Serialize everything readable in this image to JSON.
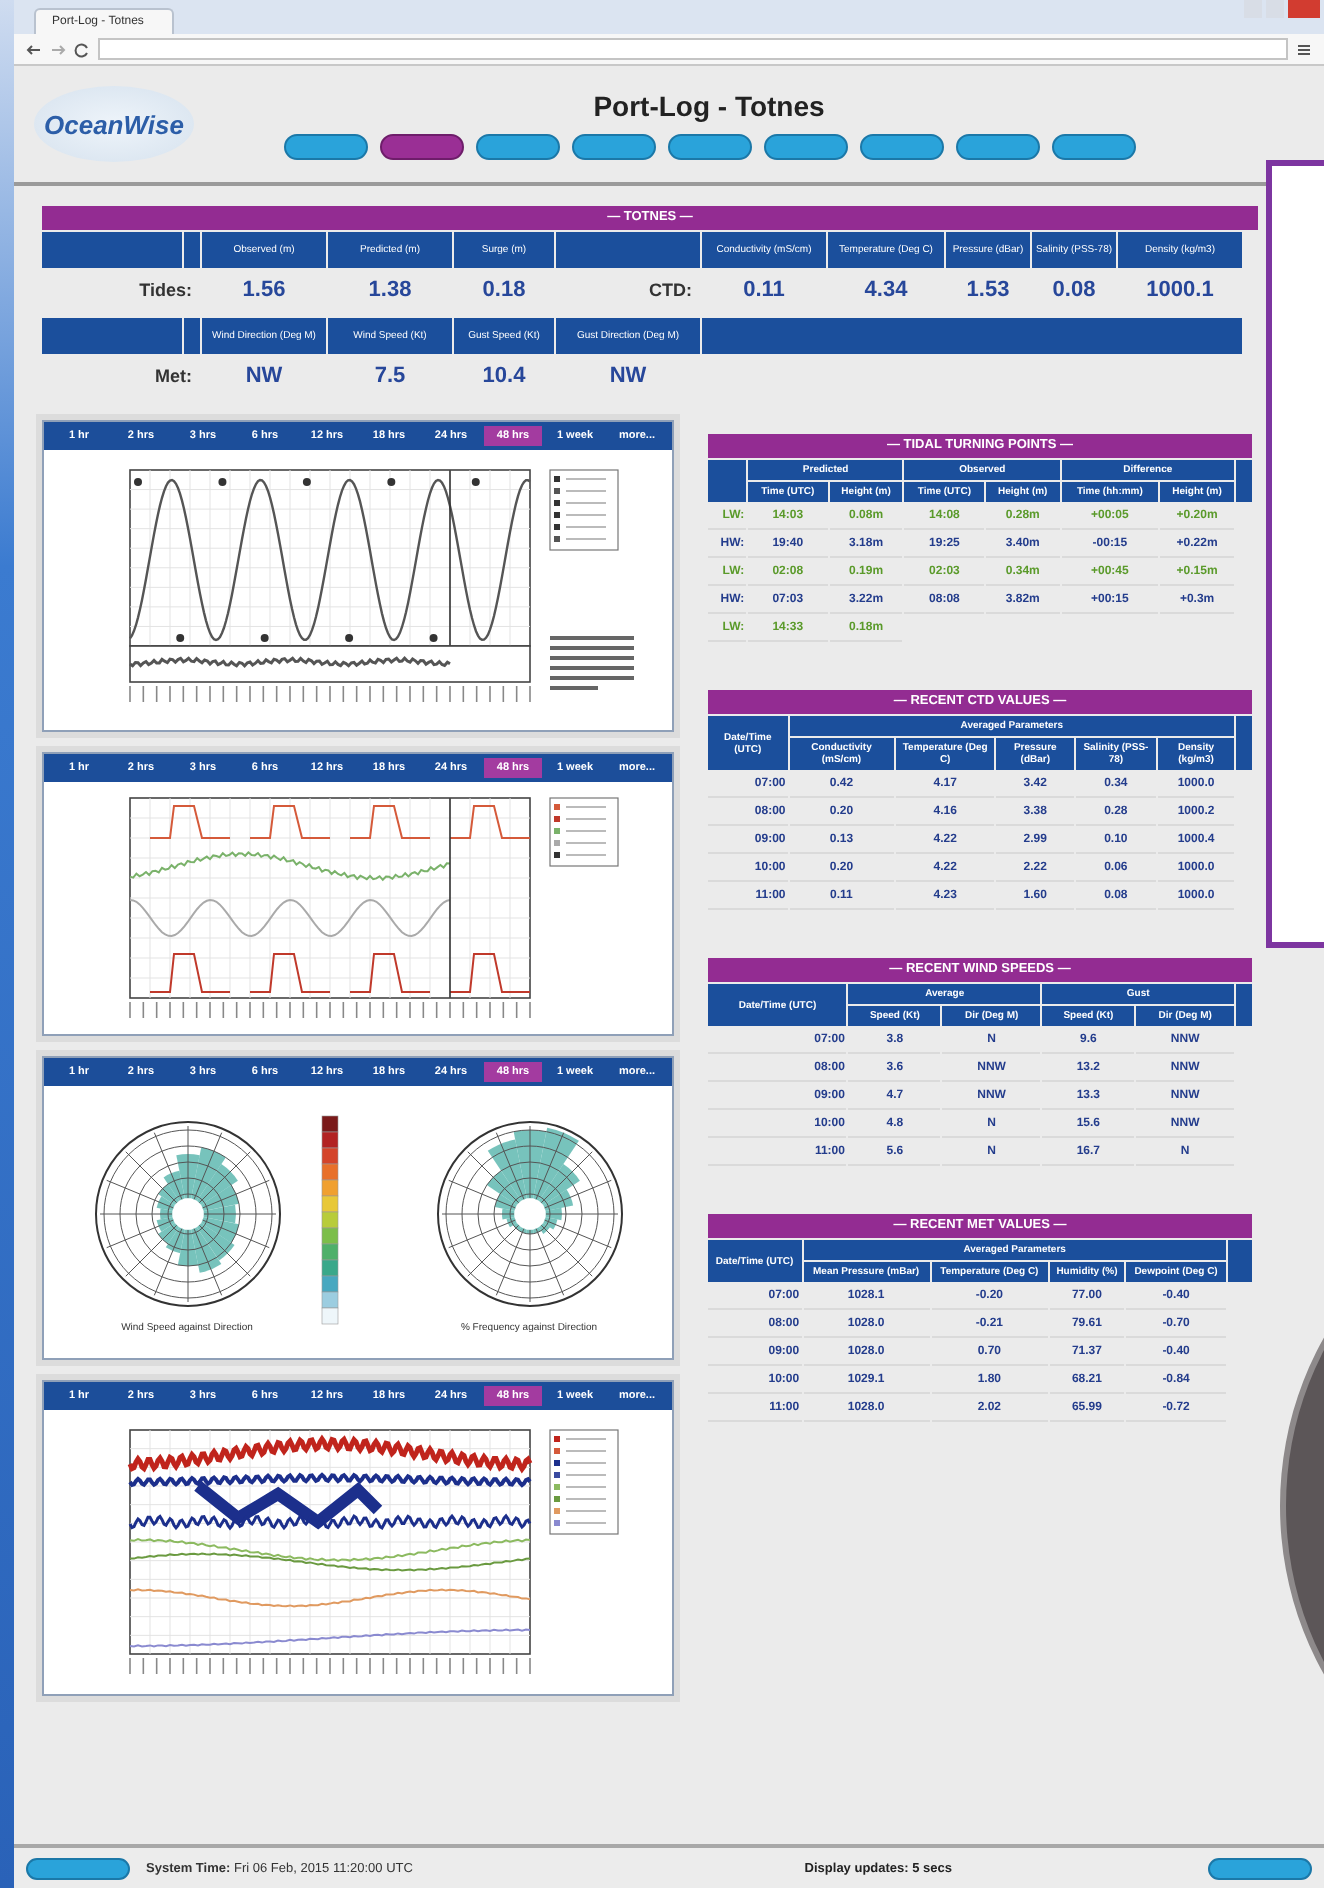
{
  "browser": {
    "tab_title": "Port-Log - Totnes"
  },
  "header": {
    "logo": "OceanWise",
    "title": "Port-Log - Totnes",
    "nav": [
      {
        "selected": false
      },
      {
        "selected": true
      },
      {
        "selected": false
      },
      {
        "selected": false
      },
      {
        "selected": false
      },
      {
        "selected": false
      },
      {
        "selected": false
      },
      {
        "selected": false
      },
      {
        "selected": false
      }
    ]
  },
  "summary": {
    "title": "— TOTNES —",
    "tides": {
      "label": "Tides:",
      "columns": [
        "Observed (m)",
        "Predicted (m)",
        "Surge (m)"
      ],
      "values": [
        "1.56",
        "1.38",
        "0.18"
      ]
    },
    "ctd": {
      "label": "CTD:",
      "columns": [
        "Conductivity (mS/cm)",
        "Temperature (Deg C)",
        "Pressure (dBar)",
        "Salinity (PSS-78)",
        "Density (kg/m3)"
      ],
      "values": [
        "0.11",
        "4.34",
        "1.53",
        "0.08",
        "1000.1"
      ]
    },
    "met": {
      "label": "Met:",
      "columns": [
        "Wind Direction (Deg M)",
        "Wind Speed (Kt)",
        "Gust Speed (Kt)",
        "Gust Direction (Deg M)"
      ],
      "values": [
        "NW",
        "7.5",
        "10.4",
        "NW"
      ]
    }
  },
  "charts": [
    {
      "kind": "tide",
      "tabs": [
        {
          "label": "1 hr",
          "selected": false
        },
        {
          "label": "2 hrs",
          "selected": false
        },
        {
          "label": "3 hrs",
          "selected": false
        },
        {
          "label": "6 hrs",
          "selected": false
        },
        {
          "label": "12 hrs",
          "selected": false
        },
        {
          "label": "18 hrs",
          "selected": false
        },
        {
          "label": "24 hrs",
          "selected": false
        },
        {
          "label": "48 hrs",
          "selected": true
        },
        {
          "label": "1 week",
          "selected": false
        },
        {
          "label": "more...",
          "selected": false
        }
      ]
    },
    {
      "kind": "ctd",
      "tabs": [
        {
          "label": "1 hr",
          "selected": false
        },
        {
          "label": "2 hrs",
          "selected": false
        },
        {
          "label": "3 hrs",
          "selected": false
        },
        {
          "label": "6 hrs",
          "selected": false
        },
        {
          "label": "12 hrs",
          "selected": false
        },
        {
          "label": "18 hrs",
          "selected": false
        },
        {
          "label": "24 hrs",
          "selected": false
        },
        {
          "label": "48 hrs",
          "selected": true
        },
        {
          "label": "1 week",
          "selected": false
        },
        {
          "label": "more...",
          "selected": false
        }
      ]
    },
    {
      "kind": "wind",
      "captions": [
        "Wind Speed against Direction",
        "% Frequency against Direction"
      ],
      "tabs": [
        {
          "label": "1 hr",
          "selected": false
        },
        {
          "label": "2 hrs",
          "selected": false
        },
        {
          "label": "3 hrs",
          "selected": false
        },
        {
          "label": "6 hrs",
          "selected": false
        },
        {
          "label": "12 hrs",
          "selected": false
        },
        {
          "label": "18 hrs",
          "selected": false
        },
        {
          "label": "24 hrs",
          "selected": false
        },
        {
          "label": "48 hrs",
          "selected": true
        },
        {
          "label": "1 week",
          "selected": false
        },
        {
          "label": "more...",
          "selected": false
        }
      ]
    },
    {
      "kind": "met",
      "tabs": [
        {
          "label": "1 hr",
          "selected": false
        },
        {
          "label": "2 hrs",
          "selected": false
        },
        {
          "label": "3 hrs",
          "selected": false
        },
        {
          "label": "6 hrs",
          "selected": false
        },
        {
          "label": "12 hrs",
          "selected": false
        },
        {
          "label": "18 hrs",
          "selected": false
        },
        {
          "label": "24 hrs",
          "selected": false
        },
        {
          "label": "48 hrs",
          "selected": true
        },
        {
          "label": "1 week",
          "selected": false
        },
        {
          "label": "more...",
          "selected": false
        }
      ]
    }
  ],
  "tables": [
    {
      "title": "— TIDAL TURNING POINTS —",
      "groups": [
        "Predicted",
        "Observed",
        "Difference"
      ],
      "columns": [
        "Time (UTC)",
        "Height (m)",
        "Time (UTC)",
        "Height (m)",
        "Time (hh:mm)",
        "Height (m)"
      ],
      "rows": [
        {
          "kind": "low",
          "label": "LW:",
          "cells": [
            "14:03",
            "0.08m",
            "14:08",
            "0.28m",
            "+00:05",
            "+0.20m"
          ]
        },
        {
          "kind": "high",
          "label": "HW:",
          "cells": [
            "19:40",
            "3.18m",
            "19:25",
            "3.40m",
            "-00:15",
            "+0.22m"
          ]
        },
        {
          "kind": "low",
          "label": "LW:",
          "cells": [
            "02:08",
            "0.19m",
            "02:03",
            "0.34m",
            "+00:45",
            "+0.15m"
          ]
        },
        {
          "kind": "high",
          "label": "HW:",
          "cells": [
            "07:03",
            "3.22m",
            "08:08",
            "3.82m",
            "+00:15",
            "+0.3m"
          ]
        },
        {
          "kind": "low",
          "label": "LW:",
          "cells": [
            "14:33",
            "0.18m"
          ]
        }
      ]
    },
    {
      "title": "— RECENT CTD VALUES —",
      "row_header": "Date/Time (UTC)",
      "groups": [
        "Averaged Parameters"
      ],
      "columns": [
        "Conductivity (mS/cm)",
        "Temperature (Deg C)",
        "Pressure (dBar)",
        "Salinity (PSS-78)",
        "Density (kg/m3)"
      ],
      "rows": [
        {
          "kind": "reading",
          "label": "07:00",
          "cells": [
            "0.42",
            "4.17",
            "3.42",
            "0.34",
            "1000.0"
          ]
        },
        {
          "kind": "reading",
          "label": "08:00",
          "cells": [
            "0.20",
            "4.16",
            "3.38",
            "0.28",
            "1000.2"
          ]
        },
        {
          "kind": "reading",
          "label": "09:00",
          "cells": [
            "0.13",
            "4.22",
            "2.99",
            "0.10",
            "1000.4"
          ]
        },
        {
          "kind": "reading",
          "label": "10:00",
          "cells": [
            "0.20",
            "4.22",
            "2.22",
            "0.06",
            "1000.0"
          ]
        },
        {
          "kind": "reading",
          "label": "11:00",
          "cells": [
            "0.11",
            "4.23",
            "1.60",
            "0.08",
            "1000.0"
          ]
        }
      ]
    },
    {
      "title": "— RECENT WIND SPEEDS —",
      "row_header": "Date/Time (UTC)",
      "groups": [
        "Average",
        "Gust"
      ],
      "columns": [
        "Speed (Kt)",
        "Dir (Deg M)",
        "Speed (Kt)",
        "Dir (Deg M)"
      ],
      "rows": [
        {
          "kind": "reading",
          "label": "07:00",
          "cells": [
            "3.8",
            "N",
            "9.6",
            "NNW"
          ]
        },
        {
          "kind": "reading",
          "label": "08:00",
          "cells": [
            "3.6",
            "NNW",
            "13.2",
            "NNW"
          ]
        },
        {
          "kind": "reading",
          "label": "09:00",
          "cells": [
            "4.7",
            "NNW",
            "13.3",
            "NNW"
          ]
        },
        {
          "kind": "reading",
          "label": "10:00",
          "cells": [
            "4.8",
            "N",
            "15.6",
            "NNW"
          ]
        },
        {
          "kind": "reading",
          "label": "11:00",
          "cells": [
            "5.6",
            "N",
            "16.7",
            "N"
          ]
        }
      ]
    },
    {
      "title": "— RECENT MET VALUES —",
      "row_header": "Date/Time (UTC)",
      "groups": [
        "Averaged Parameters"
      ],
      "columns": [
        "Mean Pressure (mBar)",
        "Temperature (Deg C)",
        "Humidity (%)",
        "Dewpoint (Deg C)"
      ],
      "rows": [
        {
          "kind": "reading",
          "label": "07:00",
          "cells": [
            "1028.1",
            "-0.20",
            "77.00",
            "-0.40"
          ]
        },
        {
          "kind": "reading",
          "label": "08:00",
          "cells": [
            "1028.0",
            "-0.21",
            "79.61",
            "-0.70"
          ]
        },
        {
          "kind": "reading",
          "label": "09:00",
          "cells": [
            "1028.0",
            "0.70",
            "71.37",
            "-0.40"
          ]
        },
        {
          "kind": "reading",
          "label": "10:00",
          "cells": [
            "1029.1",
            "1.80",
            "68.21",
            "-0.84"
          ]
        },
        {
          "kind": "reading",
          "label": "11:00",
          "cells": [
            "1028.0",
            "2.02",
            "65.99",
            "-0.72"
          ]
        }
      ]
    }
  ],
  "footer": {
    "system_time_label": "System Time:",
    "system_time": "Fri 06 Feb, 2015 11:20:00 UTC",
    "updates": "Display updates: 5 secs"
  }
}
